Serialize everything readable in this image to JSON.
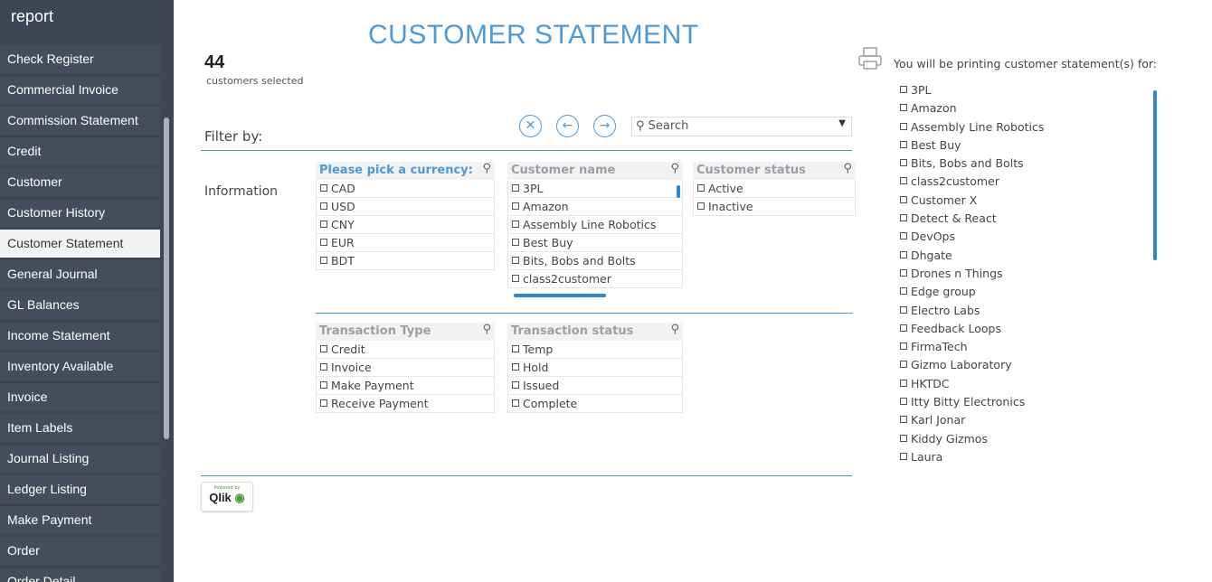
{
  "sidebar": {
    "title": "report",
    "items": [
      {
        "label": "Check Register"
      },
      {
        "label": "Commercial Invoice"
      },
      {
        "label": "Commission Statement"
      },
      {
        "label": "Credit"
      },
      {
        "label": "Customer"
      },
      {
        "label": "Customer History"
      },
      {
        "label": "Customer Statement",
        "active": true
      },
      {
        "label": "General Journal"
      },
      {
        "label": "GL Balances"
      },
      {
        "label": "Income Statement"
      },
      {
        "label": "Inventory Available"
      },
      {
        "label": "Invoice"
      },
      {
        "label": "Item Labels"
      },
      {
        "label": "Journal Listing"
      },
      {
        "label": "Ledger Listing"
      },
      {
        "label": "Make Payment"
      },
      {
        "label": "Order"
      },
      {
        "label": "Order Detail"
      }
    ]
  },
  "main": {
    "title": "CUSTOMER STATEMENT",
    "count": "44",
    "count_label": "customers selected",
    "filter_label": "Filter by:",
    "info_label": "Information",
    "search_placeholder": "Search",
    "buttons": {
      "clear": "✕",
      "back": "←",
      "forward": "→"
    }
  },
  "listboxes": {
    "currency": {
      "title": "Please pick a currency:",
      "items": [
        "CAD",
        "USD",
        "CNY",
        "EUR",
        "BDT"
      ]
    },
    "customer_name": {
      "title": "Customer name",
      "items": [
        "3PL",
        "Amazon",
        "Assembly Line Robotics",
        "Best Buy",
        "Bits, Bobs and Bolts",
        "class2customer"
      ]
    },
    "customer_status": {
      "title": "Customer status",
      "items": [
        "Active",
        "Inactive"
      ]
    },
    "transaction_type": {
      "title": "Transaction Type",
      "items": [
        "Credit",
        "Invoice",
        "Make Payment",
        "Receive Payment"
      ]
    },
    "transaction_status": {
      "title": "Transaction status",
      "items": [
        "Temp",
        "Hold",
        "Issued",
        "Complete"
      ]
    }
  },
  "print": {
    "label": "You will be printing customer statement(s) for:",
    "customers": [
      "3PL",
      "Amazon",
      "Assembly Line Robotics",
      "Best Buy",
      "Bits, Bobs and Bolts",
      "class2customer",
      "Customer X",
      "Detect & React",
      "DevOps",
      "Dhgate",
      "Drones n Things",
      "Edge group",
      "Electro Labs",
      "Feedback Loops",
      "FirmaTech",
      "Gizmo Laboratory",
      "HKTDC",
      "Itty Bitty Electronics",
      "Karl Jonar",
      "Kiddy Gizmos",
      "Laura"
    ]
  },
  "qlik": {
    "powered_by": "Powered by",
    "name": "Qlik"
  },
  "colors": {
    "accent": "#4d9ad6",
    "sidebar_bg": "#3d4654",
    "scroll": "#2f86d4"
  }
}
